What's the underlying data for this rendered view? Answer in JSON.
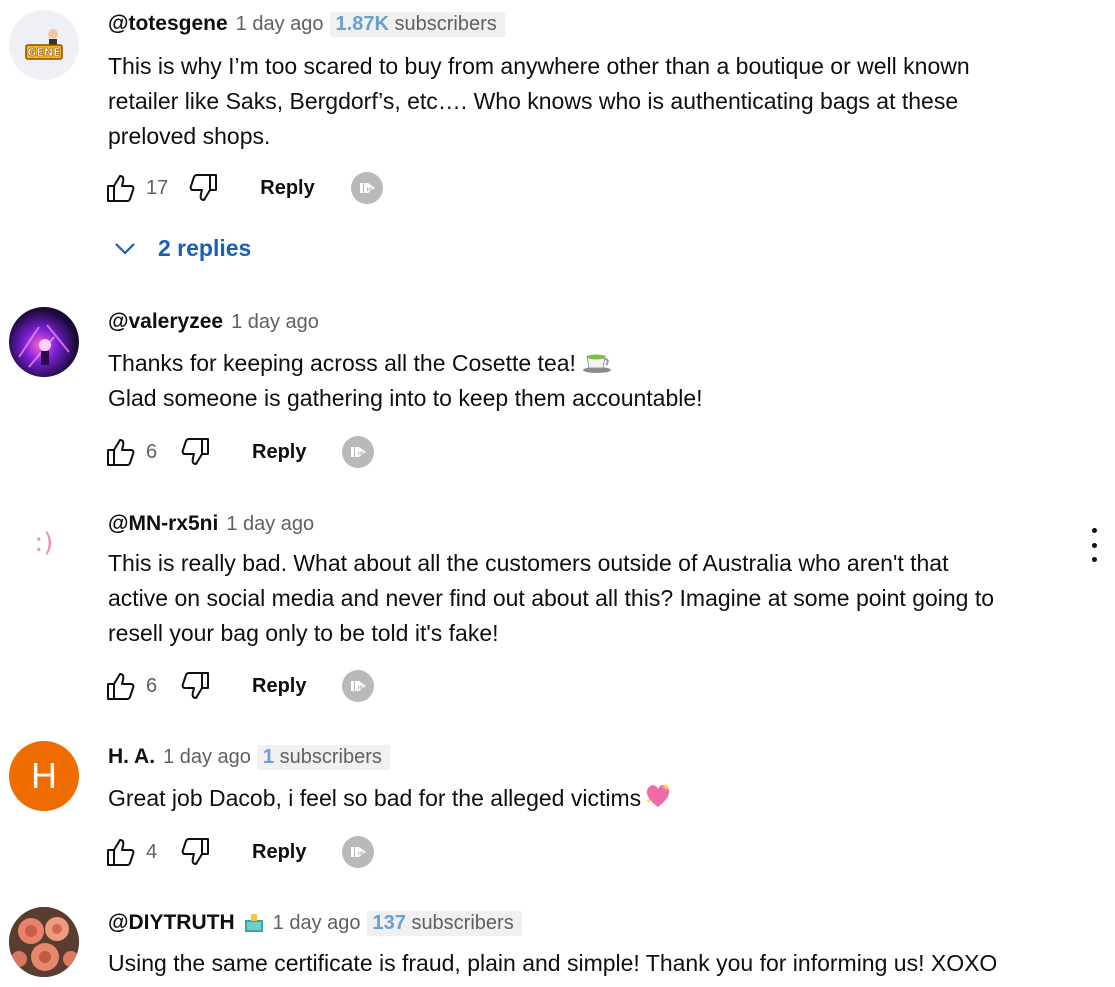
{
  "comments": [
    {
      "author": "@totesgene",
      "time": "1 day ago",
      "subscribers_count": "1.87K",
      "subscribers_label": "subscribers",
      "avatar": "avatar-logo-gene",
      "avatar_text": "GENE",
      "lines": [
        "This is why I’m too scared to buy from anywhere other than a boutique or well known",
        "retailer like Saks, Bergdorf’s, etc…. Who knows who is authenticating bags at these",
        "preloved shops."
      ],
      "likes": "17",
      "reply_label": "Reply",
      "replies_label": "2 replies"
    },
    {
      "author": "@valeryzee",
      "time": "1 day ago",
      "avatar": "avatar-neon-photo",
      "lines": [
        "Thanks for keeping across all the Cosette tea!",
        "Glad someone is gathering into to keep them accountable!"
      ],
      "emoji": "tea-cup-emoji",
      "likes": "6",
      "reply_label": "Reply"
    },
    {
      "author": "@MN-rx5ni",
      "time": "1 day ago",
      "avatar": "avatar-smiley",
      "avatar_text": ":)",
      "lines": [
        "This is really bad. What about all the customers outside of Australia who aren't that",
        "active on social media and never find out about all this? Imagine at some point going to",
        "resell your bag only to be told it's fake!"
      ],
      "likes": "6",
      "reply_label": "Reply"
    },
    {
      "author": "H. A.",
      "time": "1 day ago",
      "subscribers_count": "1",
      "subscribers_label": "subscribers",
      "avatar": "avatar-letter",
      "avatar_text": "H",
      "avatar_color": "#ef6c00",
      "lines": [
        "Great job Dacob, i feel so bad for the alleged victims"
      ],
      "emoji": "sparkling-heart-emoji",
      "likes": "4",
      "reply_label": "Reply"
    },
    {
      "author": "@DIYTRUTH",
      "time": "1 day ago",
      "subscribers_count": "137",
      "subscribers_label": "subscribers",
      "avatar": "avatar-roses-photo",
      "badge": "member-badge-icon",
      "lines": [
        "Using the same certificate is fraud, plain and simple! Thank you for informing us! XOXO"
      ]
    }
  ],
  "colors": {
    "link_blue": "#1a5fb4",
    "subscriber_count": "#6a9fd2",
    "secondary_text": "#606060",
    "avatar_orange": "#ef6c00"
  }
}
